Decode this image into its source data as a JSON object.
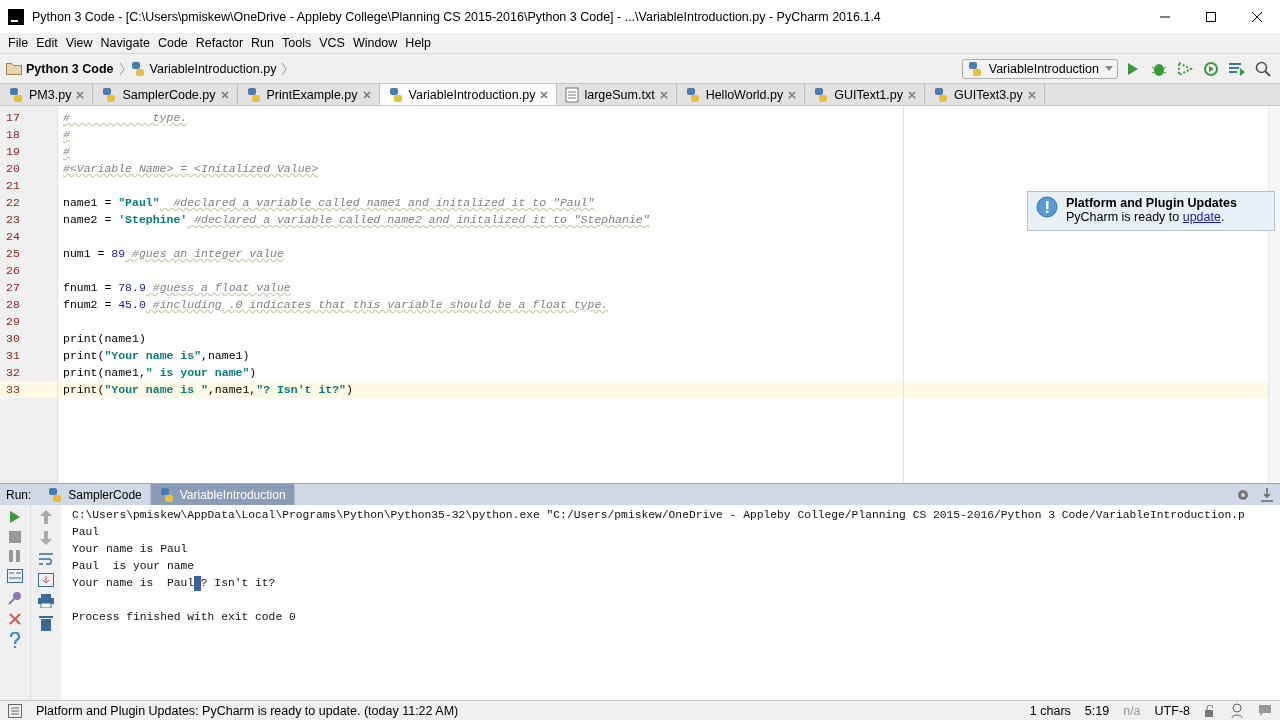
{
  "window": {
    "title": "Python 3 Code - [C:\\Users\\pmiskew\\OneDrive - Appleby College\\Planning CS 2015-2016\\Python 3 Code] - ...\\VariableIntroduction.py - PyCharm 2016.1.4"
  },
  "menu": [
    "File",
    "Edit",
    "View",
    "Navigate",
    "Code",
    "Refactor",
    "Run",
    "Tools",
    "VCS",
    "Window",
    "Help"
  ],
  "breadcrumbs": [
    "Python 3 Code",
    "VariableIntroduction.py"
  ],
  "run_config": "VariableIntroduction",
  "tabs": [
    {
      "label": "PM3.py",
      "kind": "python",
      "selected": false
    },
    {
      "label": "SamplerCode.py",
      "kind": "python",
      "selected": false
    },
    {
      "label": "PrintExample.py",
      "kind": "python",
      "selected": false
    },
    {
      "label": "VariableIntroduction.py",
      "kind": "python",
      "selected": true
    },
    {
      "label": "largeSum.txt",
      "kind": "text",
      "selected": false
    },
    {
      "label": "HelloWorld.py",
      "kind": "python",
      "selected": false
    },
    {
      "label": "GUIText1.py",
      "kind": "python",
      "selected": false
    },
    {
      "label": "GUIText3.py",
      "kind": "python",
      "selected": false
    }
  ],
  "notification": {
    "title": "Platform and Plugin Updates",
    "text": "PyCharm is ready to ",
    "link": "update",
    "after": "."
  },
  "code_lines": [
    {
      "number": "17",
      "current": false,
      "tokens": [
        {
          "kind": "comment",
          "text": "#            type."
        }
      ]
    },
    {
      "number": "18",
      "current": false,
      "tokens": [
        {
          "kind": "comment",
          "text": "#"
        }
      ]
    },
    {
      "number": "19",
      "current": false,
      "tokens": [
        {
          "kind": "comment",
          "text": "#"
        }
      ]
    },
    {
      "number": "20",
      "current": false,
      "tokens": [
        {
          "kind": "comment",
          "text": "#<Variable Name> = <Initalized Value>"
        }
      ]
    },
    {
      "number": "21",
      "current": false
    },
    {
      "number": "22",
      "current": false,
      "tokens": [
        {
          "kind": "plain",
          "text": "name1 = "
        },
        {
          "kind": "string",
          "text": "\"Paul\""
        },
        {
          "kind": "comment",
          "text": "  #declared a variable called name1 and initalized it to \"Paul\""
        }
      ]
    },
    {
      "number": "23",
      "current": false,
      "tokens": [
        {
          "kind": "plain",
          "text": "name2 = "
        },
        {
          "kind": "string",
          "text": "'Stephine'"
        },
        {
          "kind": "comment",
          "text": " #declared a variable called name2 and initalized it to \"Stephanie\""
        }
      ]
    },
    {
      "number": "24",
      "current": false
    },
    {
      "number": "25",
      "current": false,
      "tokens": [
        {
          "kind": "plain",
          "text": "num1 = "
        },
        {
          "kind": "number",
          "text": "89"
        },
        {
          "kind": "comment",
          "text": " #gues an integer value"
        }
      ]
    },
    {
      "number": "26",
      "current": false
    },
    {
      "number": "27",
      "current": false,
      "tokens": [
        {
          "kind": "plain",
          "text": "fnum1 = "
        },
        {
          "kind": "number",
          "text": "78.9"
        },
        {
          "kind": "comment",
          "text": " #guess a float value"
        }
      ]
    },
    {
      "number": "28",
      "current": false,
      "tokens": [
        {
          "kind": "plain",
          "text": "fnum2 = "
        },
        {
          "kind": "number",
          "text": "45.0"
        },
        {
          "kind": "comment",
          "text": " #including .0 indicates that this variable should be a float type."
        }
      ]
    },
    {
      "number": "29",
      "current": false
    },
    {
      "number": "30",
      "current": false,
      "tokens": [
        {
          "kind": "plain",
          "text": "print(name1)"
        }
      ]
    },
    {
      "number": "31",
      "current": false,
      "tokens": [
        {
          "kind": "plain",
          "text": "print("
        },
        {
          "kind": "string",
          "text": "\"Your name is\""
        },
        {
          "kind": "plain",
          "text": ",name1)"
        }
      ]
    },
    {
      "number": "32",
      "current": false,
      "tokens": [
        {
          "kind": "plain",
          "text": "print(name1,"
        },
        {
          "kind": "string",
          "text": "\" is your name\""
        },
        {
          "kind": "plain",
          "text": ")"
        }
      ]
    },
    {
      "number": "33",
      "current": true,
      "tokens": [
        {
          "kind": "plain",
          "text": "print("
        },
        {
          "kind": "string",
          "text": "\"Your name is \""
        },
        {
          "kind": "plain",
          "text": ",name1,"
        },
        {
          "kind": "string",
          "text": "\"? Isn't it?\""
        },
        {
          "kind": "plain",
          "text": ")"
        }
      ]
    }
  ],
  "run_panel": {
    "label": "Run:",
    "tabs": [
      {
        "label": "SamplerCode",
        "selected": false
      },
      {
        "label": "VariableIntroduction",
        "selected": true
      }
    ]
  },
  "console_lines": [
    {
      "text": "C:\\Users\\pmiskew\\AppData\\Local\\Programs\\Python\\Python35-32\\python.exe \"C:/Users/pmiskew/OneDrive - Appleby College/Planning CS 2015-2016/Python 3 Code/VariableIntroduction.p",
      "selection_after": false
    },
    {
      "text": "Paul",
      "selection_after": false
    },
    {
      "text": "Your name is Paul",
      "selection_after": false
    },
    {
      "text": "Paul  is your name",
      "selection_after": false
    },
    {
      "text": "Your name is  Paul",
      "selection_after": true,
      "rest": "? Isn't it?"
    },
    {
      "selection_after": false
    },
    {
      "text": "Process finished with exit code 0",
      "selection_after": false
    }
  ],
  "status_bar": {
    "message": "Platform and Plugin Updates: PyCharm is ready to update. (today 11:22 AM)",
    "chars": "1 chars",
    "position": "5:19",
    "na": "n/a",
    "encoding": "UTF-8"
  }
}
